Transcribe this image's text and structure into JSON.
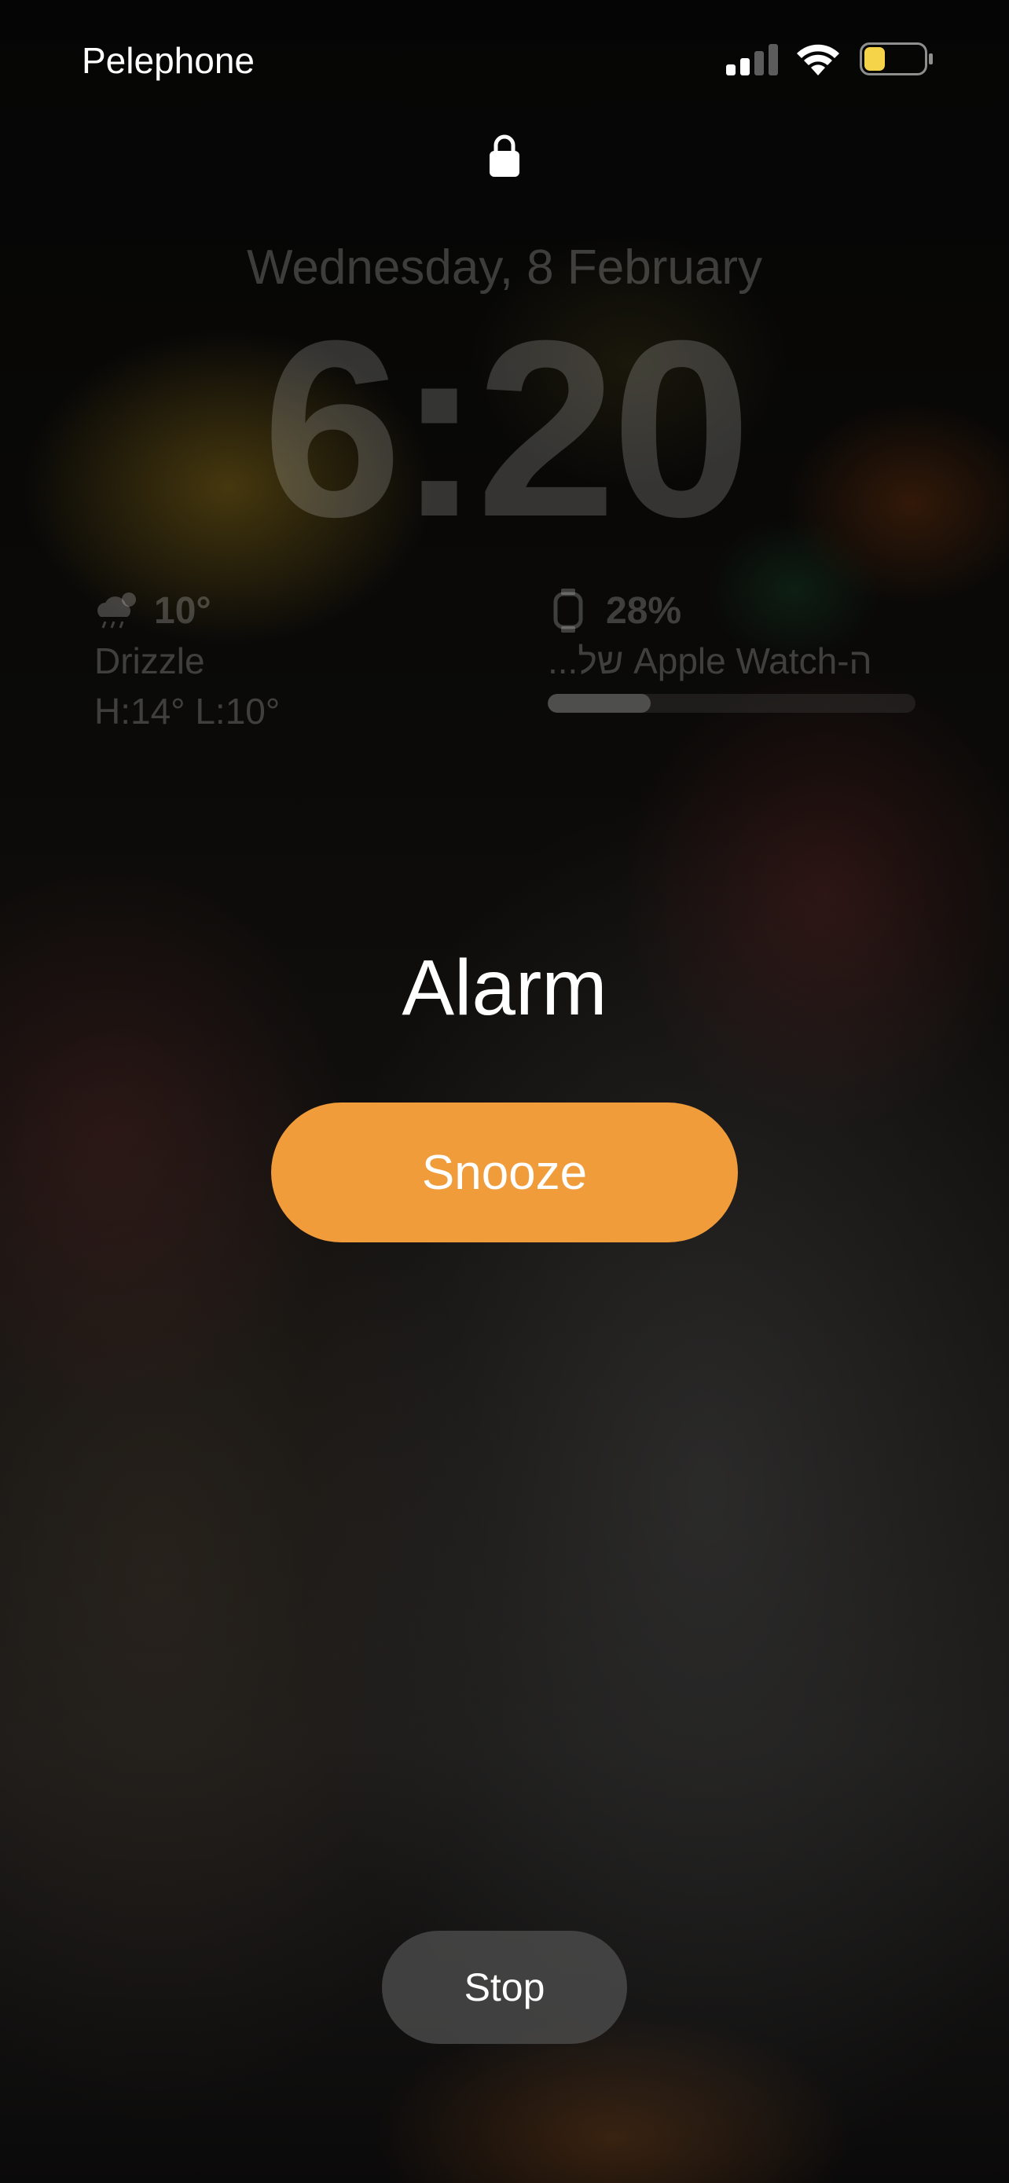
{
  "status_bar": {
    "carrier": "Pelephone",
    "signal_bars_active": 2,
    "signal_bars_total": 4,
    "battery_level": 0.35,
    "battery_color": "#f5d44a"
  },
  "lock_screen": {
    "lock_icon": "lock-icon",
    "date": "Wednesday, 8 February",
    "time": "6:20"
  },
  "weather_widget": {
    "icon": "cloud-sun-rain-icon",
    "temperature": "10°",
    "condition": "Drizzle",
    "high_low": "H:14° L:10°"
  },
  "watch_widget": {
    "icon": "apple-watch-icon",
    "battery_percent": "28%",
    "device_name": "...של Apple Watch-ה",
    "battery_level": 0.28
  },
  "alarm": {
    "title": "Alarm",
    "snooze_label": "Snooze",
    "stop_label": "Stop",
    "snooze_color": "#f09c3a"
  }
}
